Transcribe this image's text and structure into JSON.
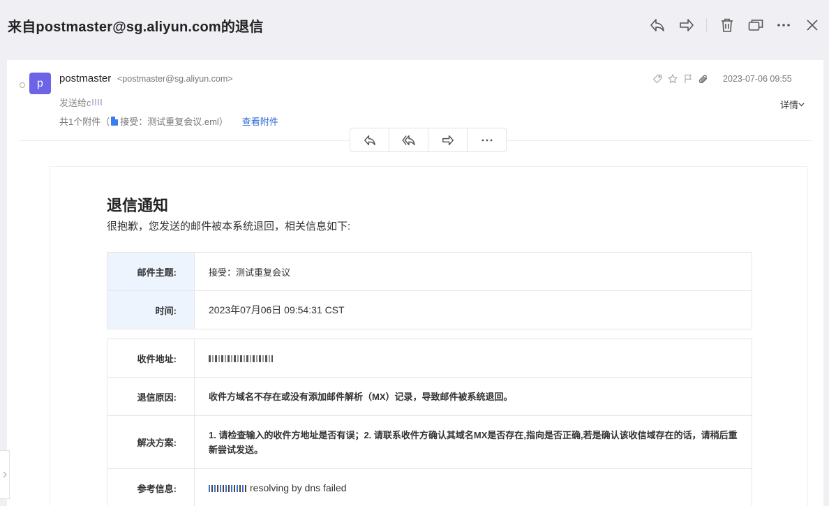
{
  "header": {
    "subject": "来自postmaster@sg.aliyun.com的退信"
  },
  "toolbar": {
    "icons": [
      "reply-icon",
      "forward-icon",
      "delete-icon",
      "new-window-icon",
      "more-icon",
      "close-icon"
    ]
  },
  "message": {
    "avatar_letter": "p",
    "sender_name": "postmaster",
    "sender_email": "<postmaster@sg.aliyun.com>",
    "send_to_label": "发送给c",
    "attachment_prefix": "共1个附件（",
    "attachment_name": "接受：测试重复会议.eml）",
    "view_attachments": "查看附件",
    "date": "2023-07-06 09:55",
    "details_label": "详情"
  },
  "notice": {
    "title": "退信通知",
    "intro": "很抱歉，您发送的邮件被本系统退回，相关信息如下:",
    "subject_label": "邮件主题:",
    "subject_value": "接受：测试重复会议",
    "time_label": "时间:",
    "time_value": "2023年07月06日 09:54:31 CST",
    "recipient_label": "收件地址:",
    "reason_label": "退信原因:",
    "reason_value": "收件方域名不存在或没有添加邮件解析（MX）记录，导致邮件被系统退回。",
    "solution_label": "解决方案:",
    "solution_value": "1. 请检查输入的收件方地址是否有误；2. 请联系收件方确认其域名MX是否存在,指向是否正确,若是确认该收信域存在的话，请稍后重新尝试发送。",
    "reference_label": "参考信息:",
    "reference_value": "resolving by dns failed"
  },
  "colors": {
    "avatar": "#6c63e6",
    "link": "#2d6ad6",
    "label_bg": "#eef4fe"
  }
}
